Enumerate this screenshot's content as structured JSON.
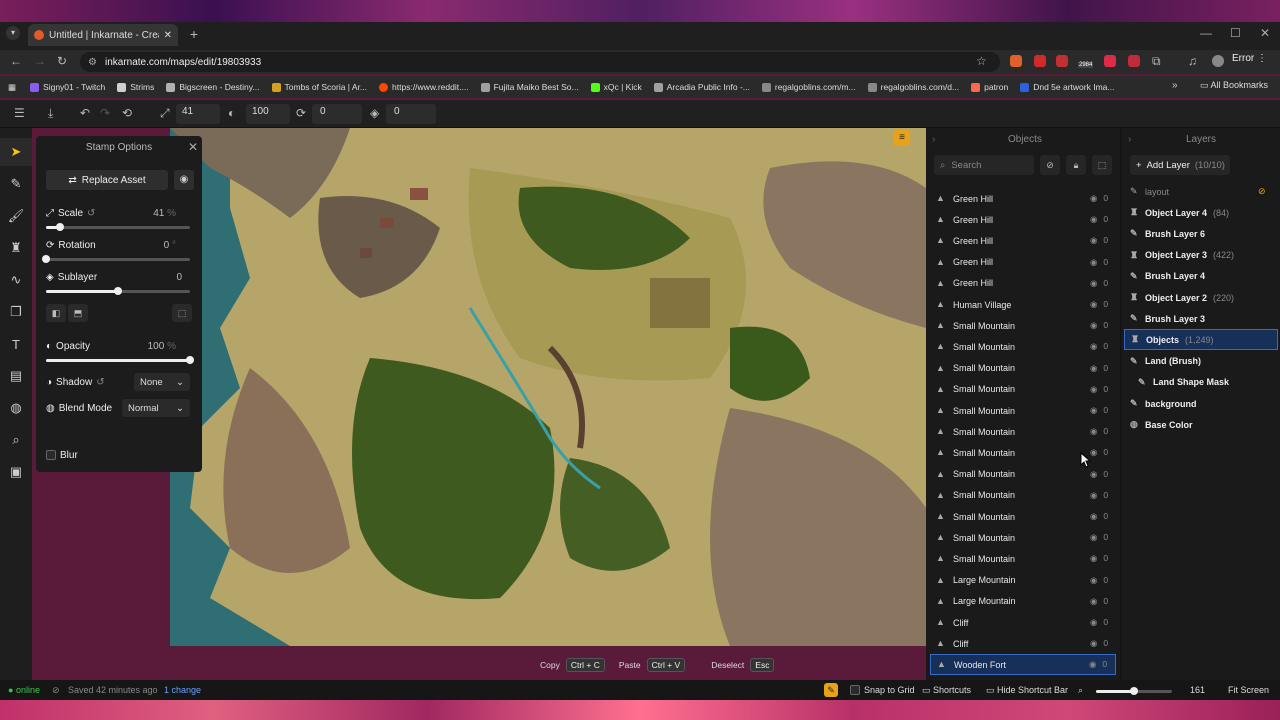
{
  "browser": {
    "tab_title": "Untitled | Inkarnate - Create Fa…",
    "url": "inkarnate.com/maps/edit/19803933",
    "error_label": "Error",
    "all_bookmarks": "All Bookmarks",
    "ext_badge": "2984",
    "bookmarks": [
      {
        "label": "Signy01 - Twitch",
        "color": "#8a5cf0"
      },
      {
        "label": "Strims",
        "color": "#d0d0d0"
      },
      {
        "label": "Bigscreen - Destiny...",
        "color": "#b0b0b0"
      },
      {
        "label": "Tombs of Scoria | Ar...",
        "color": "#d8a020"
      },
      {
        "label": "https://www.reddit....",
        "color": "#ff4500"
      },
      {
        "label": "Fujita Maiko Best So...",
        "color": "#a0a0a0"
      },
      {
        "label": "xQc | Kick",
        "color": "#53fc18"
      },
      {
        "label": "Arcadia Public Info -...",
        "color": "#a0a0a0"
      },
      {
        "label": "regalgoblins.com/m...",
        "color": "#888"
      },
      {
        "label": "regalgoblins.com/d...",
        "color": "#888"
      },
      {
        "label": "patron",
        "color": "#f96854"
      },
      {
        "label": "Dnd 5e artwork Ima...",
        "color": "#3060e0"
      }
    ]
  },
  "toolbar": {
    "size": "41",
    "opacity": "100",
    "rotation": "0",
    "layer": "0"
  },
  "stamp_options": {
    "title": "Stamp Options",
    "replace_label": "Replace Asset",
    "scale": {
      "label": "Scale",
      "value": "41",
      "unit": "%",
      "fraction": 0.1
    },
    "rotation": {
      "label": "Rotation",
      "value": "0",
      "unit": "°",
      "fraction": 0.0
    },
    "sublayer": {
      "label": "Sublayer",
      "value": "0",
      "fraction": 0.5
    },
    "opacity": {
      "label": "Opacity",
      "value": "100",
      "unit": "%",
      "fraction": 1.0
    },
    "shadow": {
      "label": "Shadow",
      "value": "None"
    },
    "blend": {
      "label": "Blend Mode",
      "value": "Normal"
    },
    "blur_label": "Blur"
  },
  "objects_panel": {
    "title": "Objects",
    "search_placeholder": "Search",
    "items": [
      {
        "name": "Green Hill",
        "count": "0"
      },
      {
        "name": "Green Hill",
        "count": "0"
      },
      {
        "name": "Green Hill",
        "count": "0"
      },
      {
        "name": "Green Hill",
        "count": "0"
      },
      {
        "name": "Green Hill",
        "count": "0"
      },
      {
        "name": "Human Village",
        "count": "0"
      },
      {
        "name": "Small Mountain",
        "count": "0"
      },
      {
        "name": "Small Mountain",
        "count": "0"
      },
      {
        "name": "Small Mountain",
        "count": "0"
      },
      {
        "name": "Small Mountain",
        "count": "0"
      },
      {
        "name": "Small Mountain",
        "count": "0"
      },
      {
        "name": "Small Mountain",
        "count": "0"
      },
      {
        "name": "Small Mountain",
        "count": "0"
      },
      {
        "name": "Small Mountain",
        "count": "0"
      },
      {
        "name": "Small Mountain",
        "count": "0"
      },
      {
        "name": "Small Mountain",
        "count": "0"
      },
      {
        "name": "Small Mountain",
        "count": "0"
      },
      {
        "name": "Small Mountain",
        "count": "0"
      },
      {
        "name": "Large Mountain",
        "count": "0"
      },
      {
        "name": "Large Mountain",
        "count": "0"
      },
      {
        "name": "Cliff",
        "count": "0"
      },
      {
        "name": "Cliff",
        "count": "0"
      },
      {
        "name": "Wooden Fort",
        "count": "0",
        "selected": true
      }
    ]
  },
  "layers_panel": {
    "title": "Layers",
    "add_label": "Add Layer",
    "add_count": "(10/10)",
    "items": [
      {
        "name": "layout",
        "count": "",
        "dim": true
      },
      {
        "name": "Object Layer 4",
        "count": "(84)"
      },
      {
        "name": "Brush Layer 6",
        "count": ""
      },
      {
        "name": "Object Layer 3",
        "count": "(422)"
      },
      {
        "name": "Brush Layer 4",
        "count": ""
      },
      {
        "name": "Object Layer 2",
        "count": "(220)"
      },
      {
        "name": "Brush Layer 3",
        "count": ""
      },
      {
        "name": "Objects",
        "count": "(1,249)",
        "selected": true
      },
      {
        "name": "Land (Brush)",
        "count": ""
      },
      {
        "name": "Land Shape Mask",
        "count": "",
        "indent": true
      },
      {
        "name": "background",
        "count": ""
      },
      {
        "name": "Base Color",
        "count": ""
      }
    ]
  },
  "shortcut_bar": {
    "copy": "Copy",
    "copy_key": "Ctrl + C",
    "paste": "Paste",
    "paste_key": "Ctrl + V",
    "deselect": "Deselect",
    "deselect_key": "Esc"
  },
  "status": {
    "online": "online",
    "saved": "Saved 42 minutes ago",
    "changes": "1 change",
    "snap": "Snap to Grid",
    "shortcuts": "Shortcuts",
    "hide_bar": "Hide Shortcut Bar",
    "zoom": "161",
    "zoom_fraction": 0.5,
    "fit": "Fit Screen"
  }
}
